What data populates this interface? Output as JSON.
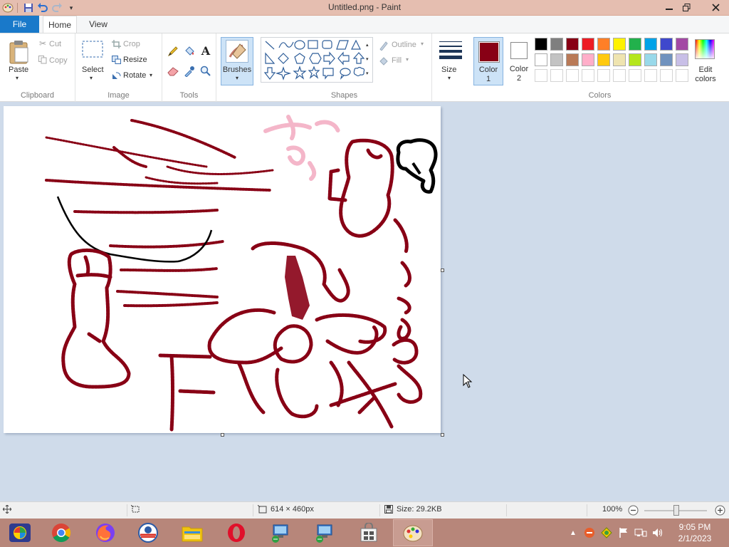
{
  "window": {
    "title": "Untitled.png - Paint"
  },
  "tabs": {
    "file": "File",
    "home": "Home",
    "view": "View"
  },
  "clipboard": {
    "paste": "Paste",
    "cut": "Cut",
    "copy": "Copy",
    "label": "Clipboard"
  },
  "image": {
    "select": "Select",
    "crop": "Crop",
    "resize": "Resize",
    "rotate": "Rotate",
    "label": "Image"
  },
  "tools": {
    "label": "Tools"
  },
  "brushes": {
    "label": "Brushes"
  },
  "shapes": {
    "outline": "Outline",
    "fill": "Fill",
    "label": "Shapes"
  },
  "size": {
    "label": "Size"
  },
  "colors": {
    "color1_line1": "Color",
    "color1_line2": "1",
    "color2_line1": "Color",
    "color2_line2": "2",
    "edit_line1": "Edit",
    "edit_line2": "colors",
    "label": "Colors",
    "color1_value": "#880015",
    "color2_value": "#ffffff",
    "palette_row1": [
      "#000000",
      "#7f7f7f",
      "#880015",
      "#ed1c24",
      "#ff7f27",
      "#fff200",
      "#22b14c",
      "#00a2e8",
      "#3f48cc",
      "#a349a4"
    ],
    "palette_row2": [
      "#ffffff",
      "#c3c3c3",
      "#b97a57",
      "#ffaec9",
      "#ffc90e",
      "#efe4b0",
      "#b5e61d",
      "#99d9ea",
      "#7092be",
      "#c8bfe7"
    ]
  },
  "status": {
    "dimensions": "614 × 460px",
    "size": "Size: 29.2KB",
    "zoom": "100%"
  },
  "clock": {
    "time": "9:05 PM",
    "date": "2/1/2023"
  }
}
